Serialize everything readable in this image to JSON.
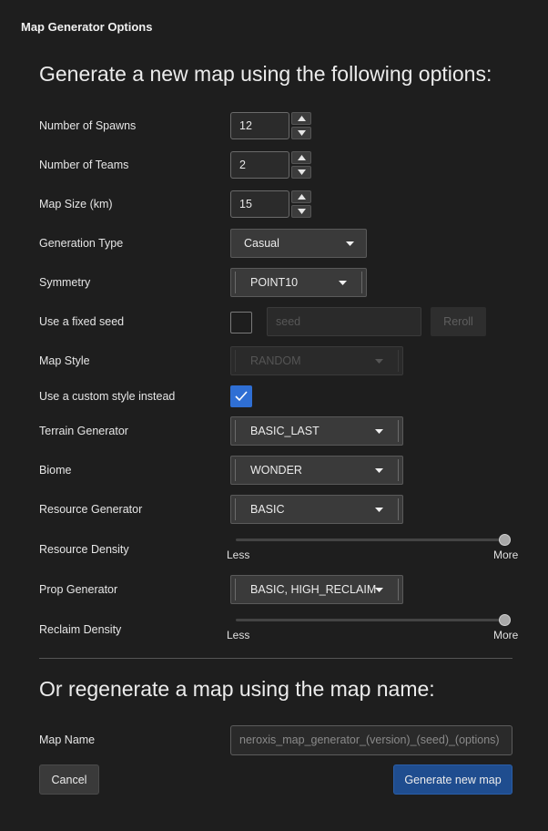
{
  "window": {
    "title": "Map Generator Options"
  },
  "heading_new": "Generate a new map using the following options:",
  "heading_regen": "Or regenerate a map using the map name:",
  "fields": {
    "spawns": {
      "label": "Number of Spawns",
      "value": "12"
    },
    "teams": {
      "label": "Number of Teams",
      "value": "2"
    },
    "map_size": {
      "label": "Map Size (km)",
      "value": "15"
    },
    "generation_type": {
      "label": "Generation Type",
      "value": "Casual"
    },
    "symmetry": {
      "label": "Symmetry",
      "value": "POINT10"
    },
    "fixed_seed": {
      "label": "Use a fixed seed",
      "checked": false,
      "seed_placeholder": "seed",
      "reroll_label": "Reroll"
    },
    "map_style": {
      "label": "Map Style",
      "value": "RANDOM",
      "disabled": true
    },
    "custom_style": {
      "label": "Use a custom style instead",
      "checked": true
    },
    "terrain_generator": {
      "label": "Terrain Generator",
      "value": "BASIC_LAST"
    },
    "biome": {
      "label": "Biome",
      "value": "WONDER"
    },
    "resource_generator": {
      "label": "Resource Generator",
      "value": "BASIC"
    },
    "resource_density": {
      "label": "Resource Density",
      "min_label": "Less",
      "max_label": "More",
      "level": 1.0
    },
    "prop_generator": {
      "label": "Prop Generator",
      "value": "BASIC, HIGH_RECLAIM"
    },
    "reclaim_density": {
      "label": "Reclaim Density",
      "min_label": "Less",
      "max_label": "More",
      "level": 1.0
    },
    "map_name": {
      "label": "Map Name",
      "placeholder": "neroxis_map_generator_(version)_(seed)_(options)"
    }
  },
  "buttons": {
    "cancel": "Cancel",
    "generate": "Generate new map"
  },
  "colors": {
    "accent": "#2f6fd4",
    "primary_button": "#1f4d8f",
    "background": "#1e1e1e"
  },
  "icons": {
    "spin_up": "chevron-up-icon",
    "spin_down": "chevron-down-icon",
    "dropdown": "caret-down-icon",
    "check": "check-icon"
  }
}
